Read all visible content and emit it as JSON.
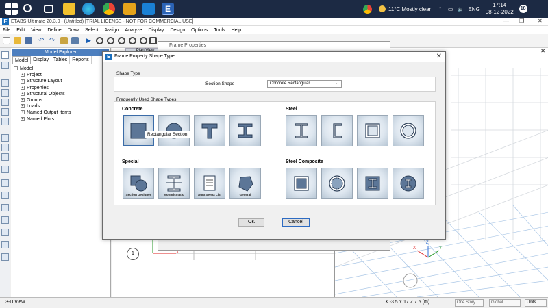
{
  "taskbar": {
    "weather": "11°C  Mostly clear",
    "language": "ENG",
    "time": "17:14",
    "date": "08-12-2022",
    "icons": [
      "windows-icon",
      "search-icon",
      "task-view-icon",
      "file-explorer-icon",
      "edge-icon",
      "chrome-icon",
      "store-icon",
      "mail-icon",
      "etabs-icon"
    ]
  },
  "app": {
    "title": "ETABS Ultimate 20.3.0 - (Untitled)  [TRIAL LICENSE - NOT FOR COMMERCIAL USE]",
    "menu": [
      "File",
      "Edit",
      "View",
      "Define",
      "Draw",
      "Select",
      "Assign",
      "Analyze",
      "Display",
      "Design",
      "Options",
      "Tools",
      "Help"
    ]
  },
  "explorer": {
    "title": "Model Explorer",
    "tabs": [
      "Model",
      "Display",
      "Tables",
      "Reports"
    ],
    "root": "Model",
    "items": [
      "Project",
      "Structure Layout",
      "Properties",
      "Structural Objects",
      "Groups",
      "Loads",
      "Named Output Items",
      "Named Plots"
    ]
  },
  "views": {
    "left_tab": "Plan View",
    "grid_bubble": "1",
    "axis_x": "X",
    "axis_z": "Z",
    "axis_y": "Y"
  },
  "status": {
    "view": "3-D View",
    "coords": "X -3.5  Y 17  Z 7.5 (m)",
    "story": "One Story",
    "coord_sys": "Global",
    "units": "Units..."
  },
  "frame_properties": {
    "title": "Frame Properties"
  },
  "dialog": {
    "title": "Frame Property Shape Type",
    "shape_type_group": "Shape Type",
    "section_shape_label": "Section Shape",
    "section_shape_value": "Concrete Rectangular",
    "frequent_group": "Frequently Used Shape Types",
    "categories": {
      "concrete": "Concrete",
      "steel": "Steel",
      "special": "Special",
      "steel_composite": "Steel Composite"
    },
    "special_labels": [
      "Section Designer",
      "Nonprismatic",
      "Auto Select List",
      "General"
    ],
    "tooltip": "Rectangular Section",
    "ok": "OK",
    "cancel": "Cancel"
  },
  "colors": {
    "taskbar": "#1c2a44",
    "accent": "#1b6fbd",
    "selected_border": "#3b6ca8"
  }
}
